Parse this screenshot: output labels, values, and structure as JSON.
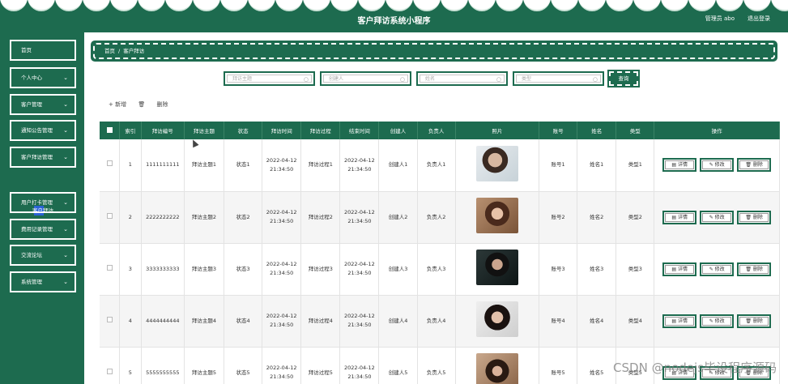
{
  "header": {
    "title": "客户拜访系统小程序",
    "user": "管理员 abo",
    "logout": "退出登录"
  },
  "sidebar": {
    "items": [
      {
        "label": "首页",
        "chevron": false
      },
      {
        "label": "个人中心",
        "chevron": true
      },
      {
        "label": "客户管理",
        "chevron": true
      },
      {
        "label": "通知公告管理",
        "chevron": true
      },
      {
        "label": "客户拜访管理",
        "chevron": true
      },
      {
        "label": "用户打卡管理",
        "chevron": true
      },
      {
        "label": "费用记录管理",
        "chevron": true
      },
      {
        "label": "交流论坛",
        "chevron": true
      },
      {
        "label": "系统管理",
        "chevron": true
      }
    ],
    "sub_item": "客户拜访"
  },
  "breadcrumb": {
    "home": "首页",
    "sep": "/",
    "current": "客户拜访"
  },
  "search": {
    "fields": [
      {
        "placeholder": "拜访主题"
      },
      {
        "placeholder": "创建人"
      },
      {
        "placeholder": "姓名"
      },
      {
        "placeholder": "类型"
      }
    ],
    "button": "查询"
  },
  "actions": {
    "add": "+ 新增",
    "delete": "删除"
  },
  "table": {
    "headers": [
      "索引",
      "拜访编号",
      "拜访主题",
      "状态",
      "拜访时间",
      "拜访过程",
      "结束时间",
      "创建人",
      "负责人",
      "照片",
      "账号",
      "姓名",
      "类型",
      "操作"
    ],
    "op_labels": {
      "detail": "详情",
      "edit": "修改",
      "delete": "删除"
    },
    "rows": [
      {
        "index": "1",
        "code": "1111111111",
        "topic": "拜访主题1",
        "status": "状态1",
        "visit_time": "2022-04-12 21:34:50",
        "process": "拜访过程1",
        "end_time": "2022-04-12 21:34:50",
        "creator": "创建人1",
        "owner": "负责人1",
        "account": "账号1",
        "name": "姓名1",
        "type": "类型1"
      },
      {
        "index": "2",
        "code": "2222222222",
        "topic": "拜访主题2",
        "status": "状态2",
        "visit_time": "2022-04-12 21:34:50",
        "process": "拜访过程2",
        "end_time": "2022-04-12 21:34:50",
        "creator": "创建人2",
        "owner": "负责人2",
        "account": "账号2",
        "name": "姓名2",
        "type": "类型2"
      },
      {
        "index": "3",
        "code": "3333333333",
        "topic": "拜访主题3",
        "status": "状态3",
        "visit_time": "2022-04-12 21:34:50",
        "process": "拜访过程3",
        "end_time": "2022-04-12 21:34:50",
        "creator": "创建人3",
        "owner": "负责人3",
        "account": "账号3",
        "name": "姓名3",
        "type": "类型3"
      },
      {
        "index": "4",
        "code": "4444444444",
        "topic": "拜访主题4",
        "status": "状态4",
        "visit_time": "2022-04-12 21:34:50",
        "process": "拜访过程4",
        "end_time": "2022-04-12 21:34:50",
        "creator": "创建人4",
        "owner": "负责人4",
        "account": "账号4",
        "name": "姓名4",
        "type": "类型4"
      },
      {
        "index": "5",
        "code": "5555555555",
        "topic": "拜访主题5",
        "status": "状态5",
        "visit_time": "2022-04-12 21:34:50",
        "process": "拜访过程5",
        "end_time": "2022-04-12 21:34:50",
        "creator": "创建人5",
        "owner": "负责人5",
        "account": "账号5",
        "name": "姓名5",
        "type": "类型5"
      }
    ]
  },
  "watermark": "CSDN @nodejs毕设程序源码",
  "colors": {
    "primary": "#1d6b4f",
    "accent": "#2a62d6"
  }
}
